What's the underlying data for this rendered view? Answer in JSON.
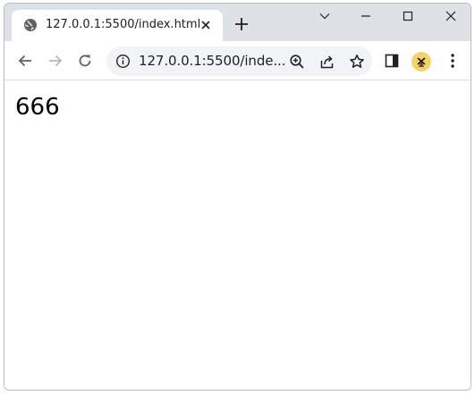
{
  "tab": {
    "title": "127.0.0.1:5500/index.html",
    "favicon": "globe-icon",
    "close_icon": "close-icon"
  },
  "new_tab_icon": "plus-icon",
  "window_controls": [
    "chevron-down-icon",
    "minimize-icon",
    "maximize-icon",
    "close-icon"
  ],
  "toolbar": {
    "back_icon": "arrow-left-icon",
    "forward_icon": "arrow-right-icon",
    "reload_icon": "reload-icon",
    "site_info_icon": "info-icon",
    "url": "127.0.0.1:5500/inde...",
    "zoom_icon": "zoom-icon",
    "share_icon": "share-icon",
    "bookmark_icon": "star-icon",
    "side_panel_icon": "side-panel-icon",
    "menu_icon": "kebab-menu-icon"
  },
  "colors": {
    "tabstrip_bg": "#dee1e6",
    "omnibox_bg": "#f1f3f4",
    "avatar_bg": "#f6d365"
  },
  "page": {
    "content": "666"
  }
}
